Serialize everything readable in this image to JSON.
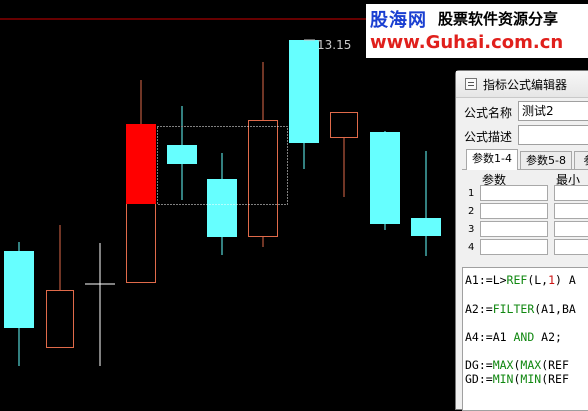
{
  "chart": {
    "price_label": "13.15",
    "colors": {
      "up_candle_outline": "#e06a4a",
      "down_candle_fill": "#66ffff",
      "highlight_fill": "#ff0000",
      "reference_line": "#cc0000",
      "selection_border": "#ffffff"
    }
  },
  "watermark": {
    "brand": "股海网",
    "slogan": "股票软件资源分享",
    "url": "www.Guhai.com.cn"
  },
  "dialog": {
    "title": "指标公式编辑器",
    "name_label": "公式名称",
    "name_value": "测试2",
    "desc_label": "公式描述",
    "desc_value": "",
    "tabs": [
      "参数1-4",
      "参数5-8",
      "参"
    ],
    "param_header": "参数",
    "min_header": "最小",
    "row_numbers": [
      "1",
      "2",
      "3",
      "4"
    ],
    "code_lines": [
      {
        "parts": [
          "A1:=L>",
          "REF",
          "(L,",
          "1",
          ") A"
        ]
      },
      {
        "parts": [
          "A2:=",
          "FILTER",
          "(A1,BA"
        ]
      },
      {
        "parts": [
          "A4:=A1 ",
          "AND",
          " A2;"
        ]
      },
      {
        "parts": [
          "DG:=",
          "MAX",
          "(",
          "MAX",
          "(REF"
        ]
      },
      {
        "parts": [
          "GD:=",
          "MIN",
          "(",
          "MIN",
          "(REF"
        ]
      }
    ]
  }
}
